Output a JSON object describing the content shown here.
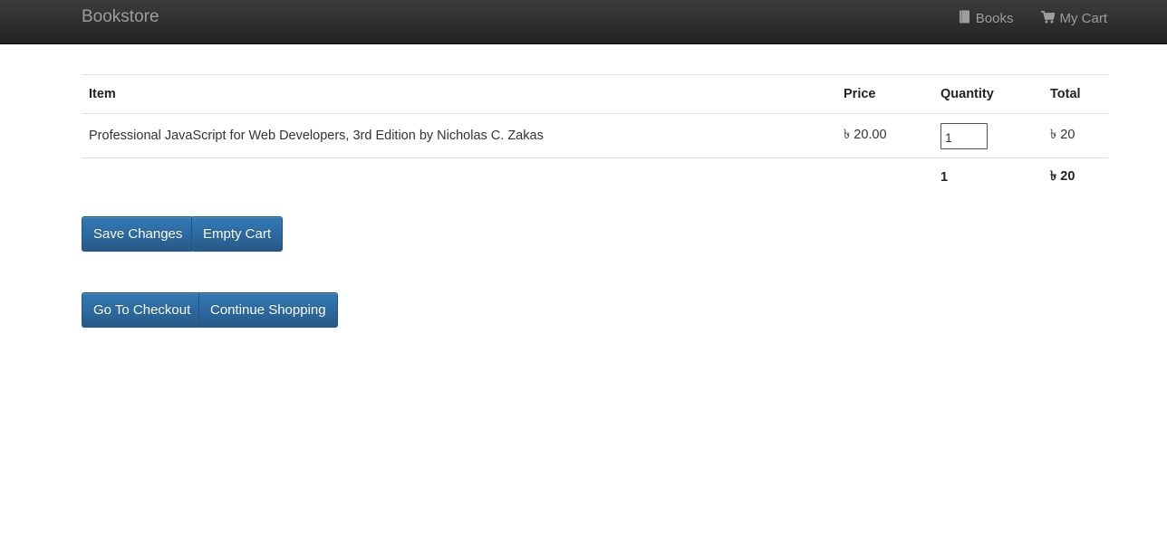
{
  "navbar": {
    "brand": "Bookstore",
    "links": [
      {
        "label": "Books",
        "icon": "book-icon"
      },
      {
        "label": "My Cart",
        "icon": "shopping-cart-icon"
      }
    ]
  },
  "cart": {
    "headers": {
      "item": "Item",
      "price": "Price",
      "quantity": "Quantity",
      "total": "Total"
    },
    "rows": [
      {
        "item": "Professional JavaScript for Web Developers, 3rd Edition by Nicholas C. Zakas",
        "price": "৳ 20.00",
        "quantity": "1",
        "total": "৳ 20"
      }
    ],
    "footer": {
      "quantity": "1",
      "total": "৳ 20"
    }
  },
  "buttons": {
    "save": "Save Changes",
    "empty": "Empty Cart",
    "checkout": "Go To Checkout",
    "continue": "Continue Shopping"
  },
  "colors": {
    "navbar": "#222222",
    "button": "#337ab7",
    "navbar_text": "#9d9d9d"
  }
}
